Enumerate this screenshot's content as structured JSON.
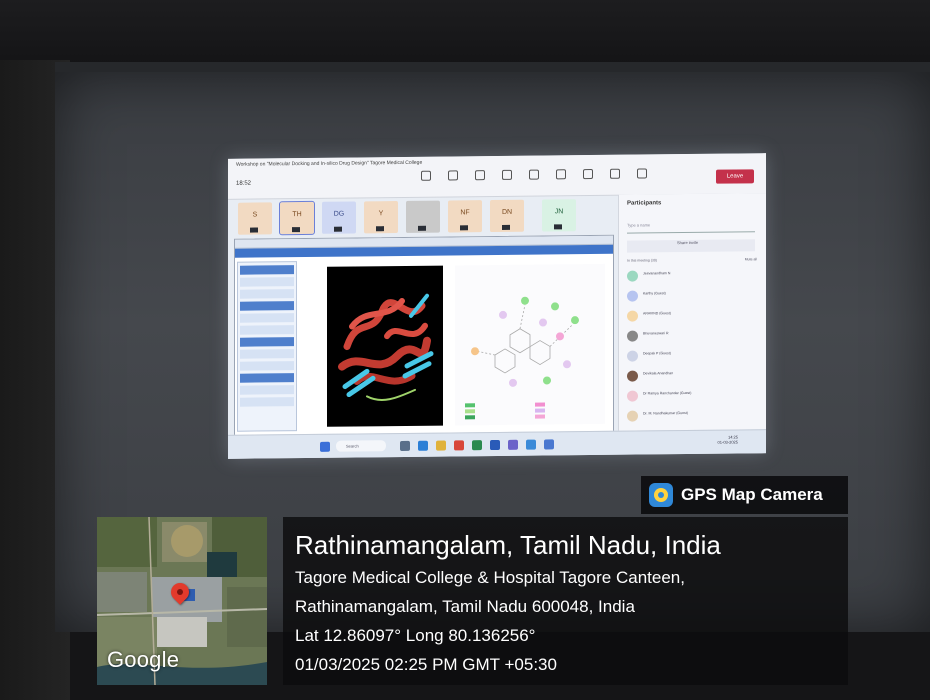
{
  "projection": {
    "meeting_title": "Workshop on \"Molecular Docking and In-silico Drug Design\" Tagore Medical College",
    "meeting_time": "18:52",
    "leave_label": "Leave",
    "toolbar_icons": [
      "chat-icon",
      "people-icon",
      "raise-hand-icon",
      "react-icon",
      "view-icon",
      "more-icon",
      "camera-icon",
      "mic-icon",
      "share-icon"
    ],
    "participant_tiles": [
      {
        "initials": "S"
      },
      {
        "initials": "TH"
      },
      {
        "initials": "DG"
      },
      {
        "initials": "Y"
      },
      {
        "initials": ""
      },
      {
        "initials": "NF"
      },
      {
        "initials": "DN"
      },
      {
        "initials": "JN"
      }
    ],
    "panel_title": "Participants",
    "search_placeholder": "Type a name",
    "share_invite": "Share invite",
    "in_meeting": "In this meeting (30)",
    "mute_all": "Mute all",
    "participants": [
      "Jeevanandham N",
      "Karthy (Guest)",
      "ARAVIND (Guest)",
      "Bhuvaneswari R",
      "Deepak P (Guest)",
      "Devikala Anandhan",
      "Dr Ramya Ranchandar (Guest)",
      "Dr. M. Nandhakumar (Guest)"
    ],
    "taskbar_search": "Search",
    "taskbar_time": "14:25",
    "taskbar_date": "01-03-2025"
  },
  "brand": {
    "name": "GPS Map Camera"
  },
  "map": {
    "provider": "Google"
  },
  "location": {
    "title": "Rathinamangalam, Tamil Nadu, India",
    "address_line1": "Tagore Medical College & Hospital Tagore Canteen,",
    "address_line2": "Rathinamangalam, Tamil Nadu 600048, India",
    "coords": "Lat 12.86097° Long 80.136256°",
    "datetime": "01/03/2025 02:25 PM GMT +05:30"
  },
  "colors": {
    "leave_red": "#c4314b",
    "teams_accent": "#6b7fd7",
    "protein_red": "#d0453a",
    "protein_cyan": "#48c8e8"
  }
}
